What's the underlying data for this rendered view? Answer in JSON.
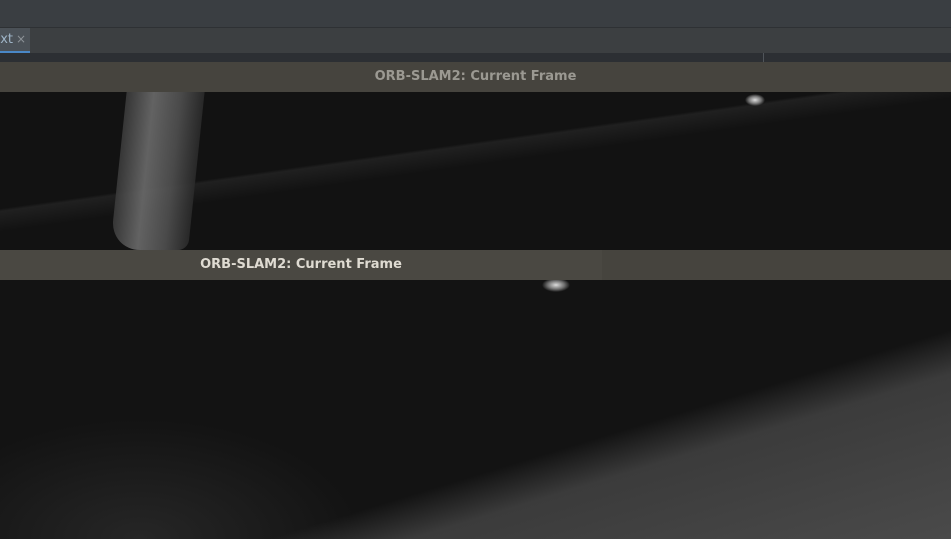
{
  "ide": {
    "tab": {
      "label": "xt",
      "close_glyph": "×"
    }
  },
  "windows": {
    "back": {
      "title": "ORB-SLAM2: Current Frame"
    },
    "front": {
      "title": "ORB-SLAM2: Current Frame"
    }
  },
  "colors": {
    "titlebar": "#4a4842",
    "ide_background": "#3c3f41",
    "tab_underline": "#4a88c7"
  }
}
